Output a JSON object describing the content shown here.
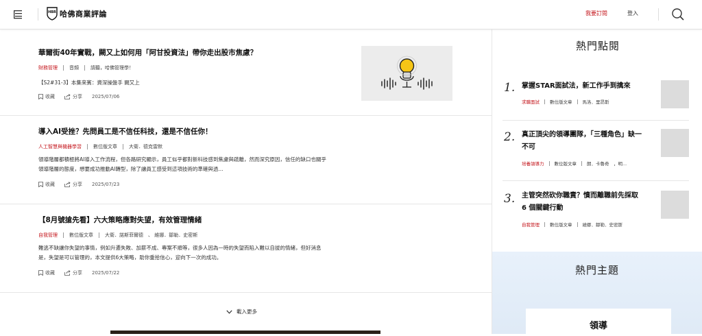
{
  "header": {
    "logo_text": "哈佛商業評論",
    "logo_badge": "HBR",
    "subscribe_label": "我要訂閱",
    "login_label": "登入"
  },
  "articles": [
    {
      "title": "華爾街40年實戰，闕又上如何用「阿甘投資法」帶你走出股市焦慮？",
      "category": "財務管理",
      "type": "音頻",
      "author": "請聽，哈佛管理學！",
      "summary": "【S2#31-3】本集來賓：資深操盤手 闕又上",
      "save_label": "收藏",
      "share_label": "分享",
      "date": "2025/07/06"
    },
    {
      "title": "導入AI受挫？先問員工是不信任科技，還是不信任你！",
      "category": "人工智慧與機器學習",
      "type": "數位版文章",
      "author": "大衛．德克雷默",
      "summary": "領導階層都積極將AI導入工作流程，但各路研究顯示，員工似乎都對新科技感到焦慮與疏離，然而深究原因，信任的缺口也關乎領導階層的態度，想要成功推動AI轉型，除了讓員工感受到這項技術的準確與透...",
      "save_label": "收藏",
      "share_label": "分享",
      "date": "2025/07/23"
    },
    {
      "title": "【8月號搶先看】六大策略應對失望，有效管理情緒",
      "category": "自我管理",
      "type": "數位版文章",
      "author": "大衛．諾斯菲爾德　、 維娜．鄒勒．史密斯",
      "summary": "難逃不缺讓你失望的事情，例如升遷失敗、加薪不成、專案不順等，很多人因為一時的失望而陷入難以自拔的情緒，但好消息是，失望是可以管理的，本文提供6大策略，助你重拾信心，迎向下一次的成功。",
      "save_label": "收藏",
      "share_label": "分享",
      "date": "2025/07/22"
    }
  ],
  "load_more_label": "載入更多",
  "sidebar": {
    "popular_title": "熱門點閱",
    "popular": [
      {
        "num": "1.",
        "title": "掌握STAR面試法，新工作手到擒來",
        "category": "求職面試",
        "type": "數位版文章",
        "author": "馬洛．里昂斯"
      },
      {
        "num": "2.",
        "title": "真正頂尖的領導團隊，「三種角色」缺一不可",
        "category": "培養領導力",
        "type": "數位版文章",
        "author": "朗．卡魯奇　，明..."
      },
      {
        "num": "3.",
        "title": "主管突然砍你職責？憤而離職前先採取 6 個關鍵行動",
        "category": "自我管理",
        "type": "數位版文章",
        "author": "維娜．鄒勒．史密斯"
      }
    ],
    "topics_title": "熱門主題",
    "topic_card": "領導"
  },
  "colors": {
    "accent": "#c4161c",
    "topics_bg": "#e5eef8"
  },
  "icons": [
    "menu-icon",
    "logo-shield-icon",
    "search-icon",
    "bookmark-icon",
    "share-icon",
    "chevron-down-icon",
    "lightbulb-microphone-icon"
  ]
}
